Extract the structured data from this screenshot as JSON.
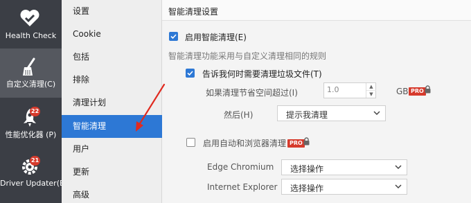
{
  "leftbar": {
    "items": [
      {
        "label": "Health Check",
        "icon": "heart-icon"
      },
      {
        "label": "自定义清理(C)",
        "icon": "broom-icon"
      },
      {
        "label": "性能优化器 (P)",
        "icon": "rocket-icon",
        "badge": "22"
      },
      {
        "label": "Driver Updater(E)",
        "icon": "gear-icon",
        "badge": "21"
      }
    ]
  },
  "midlist": {
    "items": [
      "设置",
      "Cookie",
      "包括",
      "排除",
      "清理计划",
      "智能清理",
      "用户",
      "更新",
      "高级"
    ],
    "active_index": 5
  },
  "content": {
    "title": "智能清理设置",
    "enable_smart": {
      "label": "启用智能清理(E)",
      "checked": true
    },
    "description": "智能清理功能采用与自定义清理相同的规则",
    "notify": {
      "label": "告诉我何时需要清理垃圾文件(T)",
      "checked": true
    },
    "threshold": {
      "label": "如果清理节省空间超过(I)",
      "value": "1.0",
      "unit": "GB",
      "pro_label": "PRO"
    },
    "then": {
      "label": "然后(H)",
      "selected": "提示我清理"
    },
    "auto_browser": {
      "label": "启用自动和浏览器清理",
      "checked": false,
      "pro_label": "PRO"
    },
    "browsers": [
      {
        "name": "Edge Chromium",
        "selected": "选择操作"
      },
      {
        "name": "Internet Explorer",
        "selected": "选择操作"
      }
    ]
  },
  "colors": {
    "accent": "#2d78d5",
    "sidebar": "#3b3e45",
    "pro": "#d63a2c",
    "arrow": "#e02a1f"
  }
}
